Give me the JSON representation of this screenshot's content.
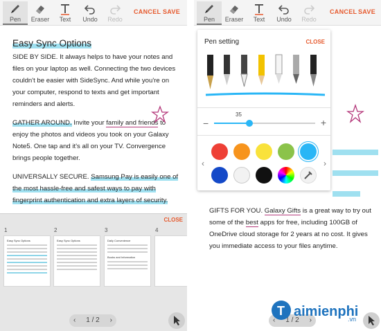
{
  "toolbar": {
    "pen": "Pen",
    "eraser": "Eraser",
    "text": "Text",
    "undo": "Undo",
    "redo": "Redo",
    "cancel": "CANCEL",
    "save": "SAVE"
  },
  "document": {
    "title": "Easy Sync Options",
    "p1": "SIDE BY SIDE. It always helps to have your notes and files on your laptop as well. Connecting the two devices couldn't be easier with SideSync. And while you're on your computer, respond to texts and get important reminders and alerts.",
    "p2_head": "GATHER AROUND.",
    "p2_a": " Invite your ",
    "p2_ul": "family and friends",
    "p2_b": " to enjoy the photos and videos you took on your Galaxy Note5. One tap and it's all on your TV. Convergence brings people together.",
    "p3_head": "UNIVERSALLY SECURE.",
    "p3_hl": "Samsung Pay is easily one of the most hassle-free and safest ways to pay with fingerprint authentication and extra layers of security.",
    "p4_head": "GIFTS FOR YOU.",
    "p4_ul": "Galaxy Gifts",
    "p4_a": " is a great way to try out some of the ",
    "p4_best": "best",
    "p4_b": " apps for free, including 100GB of OneDrive cloud storage for 2 years at no cost. It gives you immediate access to your files anytime."
  },
  "pages": {
    "close": "CLOSE",
    "numbers": [
      "1",
      "2",
      "3",
      "4"
    ],
    "pager": "1 / 2",
    "thumb1_title": "Easy Sync Options",
    "thumb2_title": "Easy Sync Options",
    "thumb3_title": "Daily Convenience",
    "thumb3_sub": "Books and Information"
  },
  "pen_setting": {
    "title": "Pen setting",
    "close": "CLOSE",
    "size": "35",
    "size_fraction": 0.35,
    "colors": [
      "#ee4036",
      "#f7941d",
      "#f9e23b",
      "#8bc34a",
      "#29b6f6",
      "#1449c8",
      "#f2f2f2",
      "#111111"
    ],
    "selected_color": "#29b6f6"
  },
  "watermark": {
    "brand": "aimienphi",
    "suffix": ".vn"
  }
}
